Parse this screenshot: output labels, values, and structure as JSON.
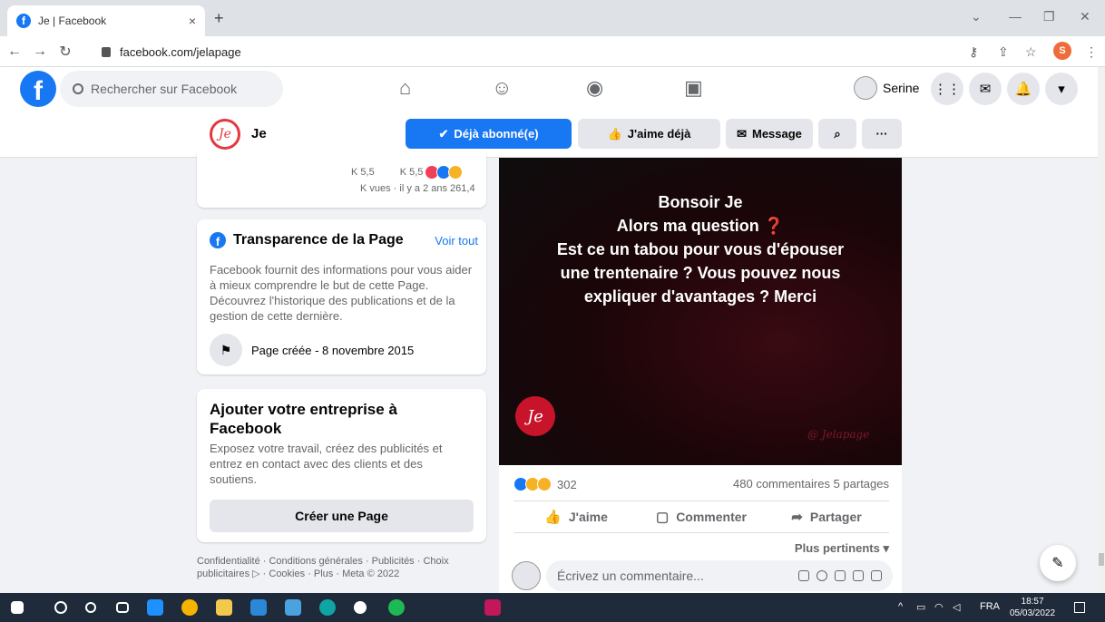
{
  "browser": {
    "tab_title": "Je | Facebook",
    "tab_close": "×",
    "new_tab": "+",
    "url": "facebook.com/jelapage",
    "profile_initial": "S"
  },
  "fb": {
    "logo": "f",
    "search_placeholder": "Rechercher sur Facebook",
    "user_name": "Serine"
  },
  "page": {
    "avatar_text": "Je",
    "name": "Je",
    "btn_subscribed": "Déjà abonné(e)",
    "btn_liked": "J'aime déjà",
    "btn_message": "Message",
    "btn_more": "···"
  },
  "video_stats": {
    "line1_a": "K 5,5",
    "line1_b": "K 5,5",
    "line2": "K vues · il y a 2 ans 261,4"
  },
  "transparency": {
    "title": "Transparence de la Page",
    "see_all": "Voir tout",
    "description": "Facebook fournit des informations pour vous aider à mieux comprendre le but de cette Page. Découvrez l'historique des publications et de la gestion de cette dernière.",
    "created": "Page créée - 8 novembre 2015"
  },
  "business": {
    "title": "Ajouter votre entreprise à Facebook",
    "description": "Exposez votre travail, créez des publicités et entrez en contact avec des clients et des soutiens.",
    "button": "Créer une Page"
  },
  "footer": {
    "text": "Confidentialité · Conditions générales · Publicités · Choix publicitaires ▷ · Cookies · Plus · Meta © 2022"
  },
  "post": {
    "img_line1": "Bonsoir Je",
    "img_line2": "Alors ma question",
    "img_q": "❓",
    "img_line3": "Est ce un tabou pour vous d'épouser",
    "img_line4": "une trentenaire ? Vous pouvez nous",
    "img_line5": "expliquer d'avantages ? Merci",
    "img_logo": "Je",
    "img_signature": "@ Jelapage",
    "reactions_count": "302",
    "comments_shares": "480 commentaires 5 partages",
    "like": "J'aime",
    "comment": "Commenter",
    "share": "Partager",
    "sort": "Plus pertinents",
    "comment_placeholder": "Écrivez un commentaire..."
  },
  "taskbar": {
    "lang": "FRA",
    "time": "18:57",
    "date": "05/03/2022"
  },
  "colors": {
    "fb_blue": "#1877f2",
    "brand_red": "#e4383f"
  }
}
